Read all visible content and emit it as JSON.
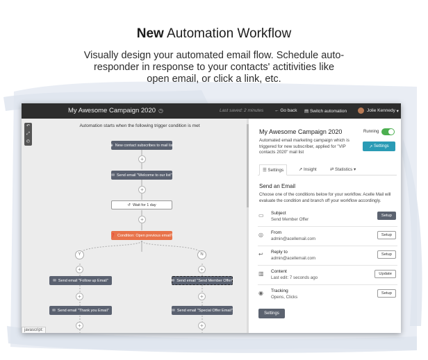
{
  "hero": {
    "title_bold": "New",
    "title_rest": " Automation Workflow",
    "subtitle": "Visually design your automated email flow. Schedule auto-responder in response to your contacts' actitivities like open email, or click a link, etc."
  },
  "topbar": {
    "campaign_title": "My Awesome Campaign 2020",
    "last_saved": "Last saved: 2 minutes",
    "go_back": "Go back",
    "switch_automation": "Switch automation",
    "user_name": "Jolie Kennedy"
  },
  "canvas": {
    "trigger_text": "Automation starts when the following trigger condition is met",
    "nodes": {
      "trigger": "New contact subscribes to mail list",
      "welcome": "Send email \"Welcome to our list\"",
      "wait": "Wait for 1 day",
      "condition": "Condition: Open previous email?",
      "follow_up": "Send email \"Follow up Email\"",
      "member_offer": "Send email \"Send Member Offer\"",
      "thank_you": "Send email \"Thank you Email\"",
      "special_offer": "Send email \"Special Offer Email\""
    },
    "branch_yes": "Y",
    "branch_no": "N",
    "status_hint": "javascript:"
  },
  "panel": {
    "title": "My Awesome Campaign 2020",
    "description": "Automated email marketing campaign which is triggered for new subscriber, applied for \"VIP contacts 2020\" mail list",
    "running_label": "Running",
    "running_on": true,
    "settings_button": "Settings",
    "tabs": [
      {
        "label": "Settings",
        "active": true
      },
      {
        "label": "Insight",
        "active": false
      },
      {
        "label": "Statistics",
        "active": false
      }
    ],
    "section_title": "Send an Email",
    "section_desc": "Choose one of the conditions below for your workflow. Acelle Mail will evaluate the condition and branch off your workflow accordingly.",
    "rows": [
      {
        "label": "Subject",
        "value": "Send Member Offer",
        "button": "Setup",
        "icon": "chat-icon"
      },
      {
        "label": "From",
        "value": "admin@acellemail.com",
        "button": "Setup",
        "icon": "target-icon"
      },
      {
        "label": "Reply to",
        "value": "admin@acellemail.com",
        "button": "Setup",
        "icon": "reply-icon"
      },
      {
        "label": "Content",
        "value": "Last edit: 7 seconds ago",
        "button": "Update",
        "icon": "columns-icon"
      },
      {
        "label": "Tracking",
        "value": "Opens, Clicks",
        "button": "Setup",
        "icon": "fingerprint-icon"
      }
    ],
    "bottom_button": "Settings"
  },
  "colors": {
    "topbar": "#2d2d2d",
    "node_gray": "#5a6170",
    "condition_orange": "#e8734a",
    "teal_button": "#2a9bb5",
    "toggle_green": "#4caf50"
  }
}
